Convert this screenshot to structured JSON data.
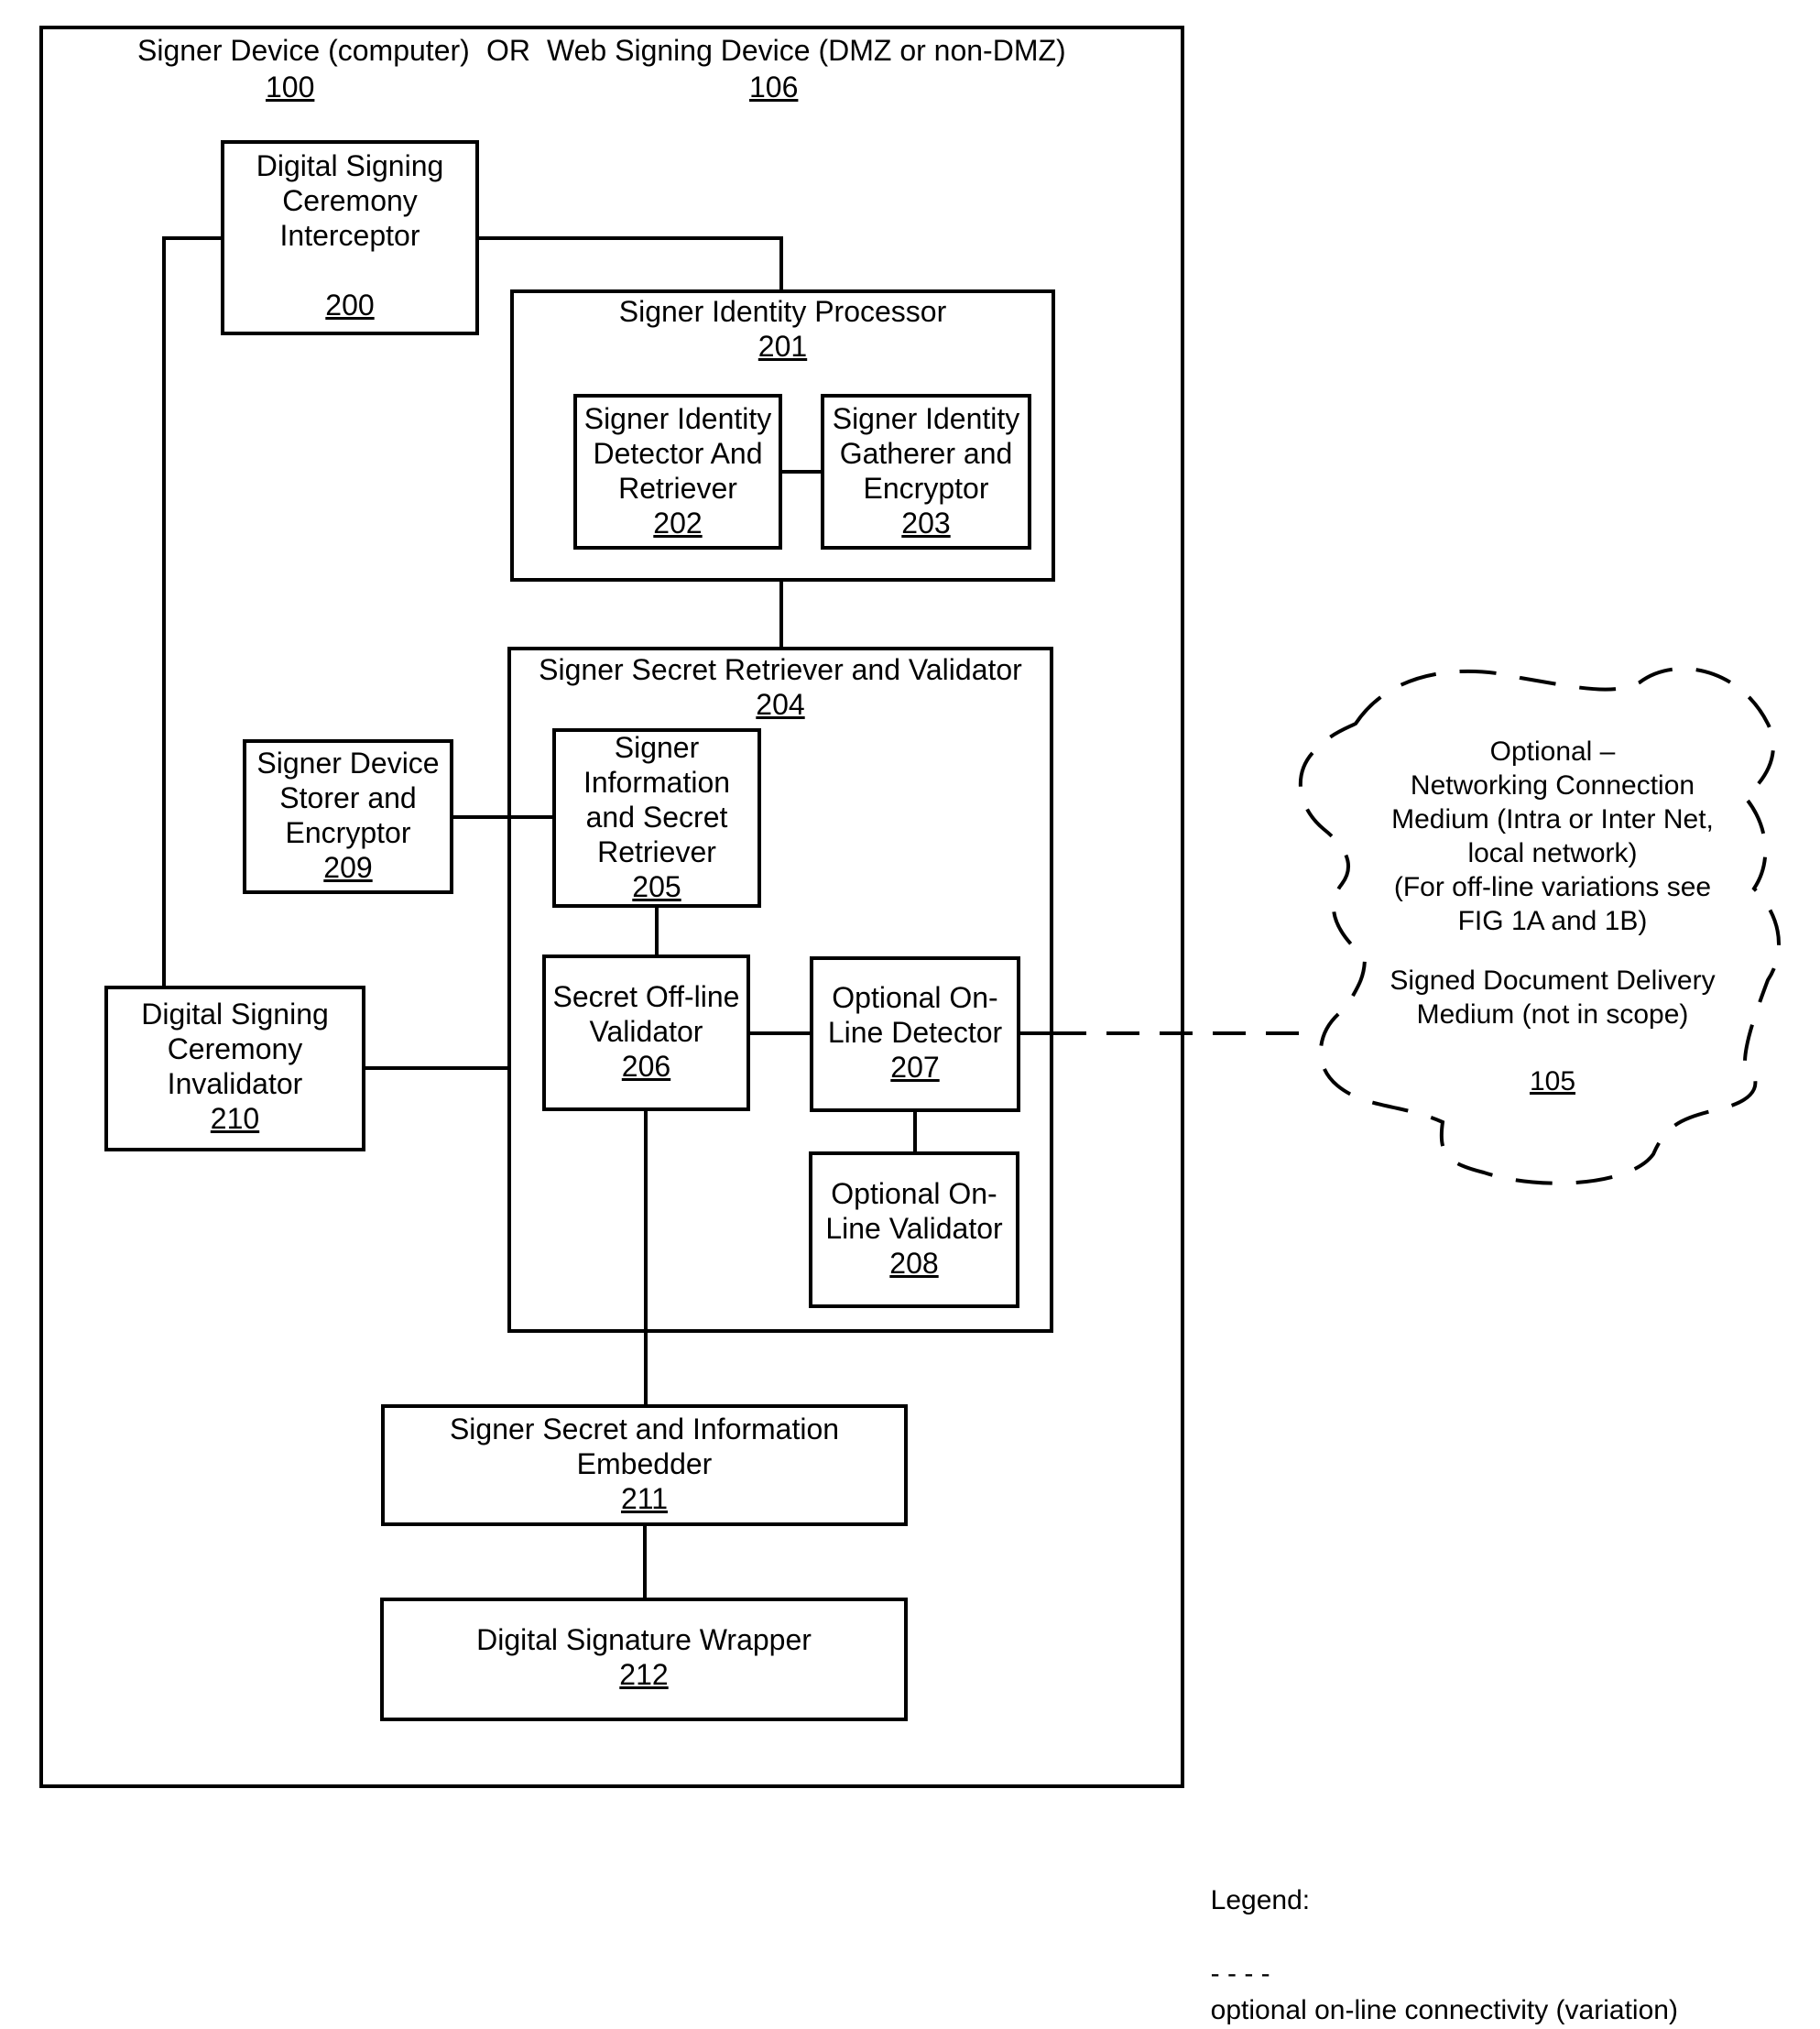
{
  "diagram": {
    "title_left": "Signer Device (computer)",
    "title_or": "OR",
    "title_right": "Web Signing Device (DMZ or non-DMZ)",
    "ref_left": "100",
    "ref_right": "106",
    "blocks": {
      "b200": {
        "label": "Digital Signing\nCeremony\nInterceptor",
        "ref": "200"
      },
      "b201": {
        "label": "Signer Identity Processor",
        "ref": "201"
      },
      "b202": {
        "label": "Signer Identity\nDetector And\nRetriever",
        "ref": "202"
      },
      "b203": {
        "label": "Signer Identity\nGatherer and\nEncryptor",
        "ref": "203"
      },
      "b204": {
        "label": "Signer Secret Retriever and Validator",
        "ref": "204"
      },
      "b205": {
        "label": "Signer\nInformation\nand Secret\nRetriever",
        "ref": "205"
      },
      "b206": {
        "label": "Secret Off-line\nValidator",
        "ref": "206"
      },
      "b207": {
        "label": "Optional On-\nLine Detector",
        "ref": "207"
      },
      "b208": {
        "label": "Optional On-\nLine Validator",
        "ref": "208"
      },
      "b209": {
        "label": "Signer Device\nStorer and\nEncryptor",
        "ref": "209"
      },
      "b210": {
        "label": "Digital Signing\nCeremony\nInvalidator",
        "ref": "210"
      },
      "b211": {
        "label": "Signer Secret and Information\nEmbedder",
        "ref": "211"
      },
      "b212": {
        "label": "Digital Signature Wrapper",
        "ref": "212"
      }
    },
    "cloud": {
      "text1": "Optional –\nNetworking Connection\nMedium (Intra or Inter Net,\nlocal network)\n(For off-line variations see\nFIG 1A and 1B)",
      "text2": "Signed Document Delivery\nMedium (not in scope)",
      "ref": "105"
    },
    "legend": {
      "title": "Legend:",
      "dash_sample": "- - - -",
      "entry": "optional on-line connectivity (variation)"
    }
  }
}
